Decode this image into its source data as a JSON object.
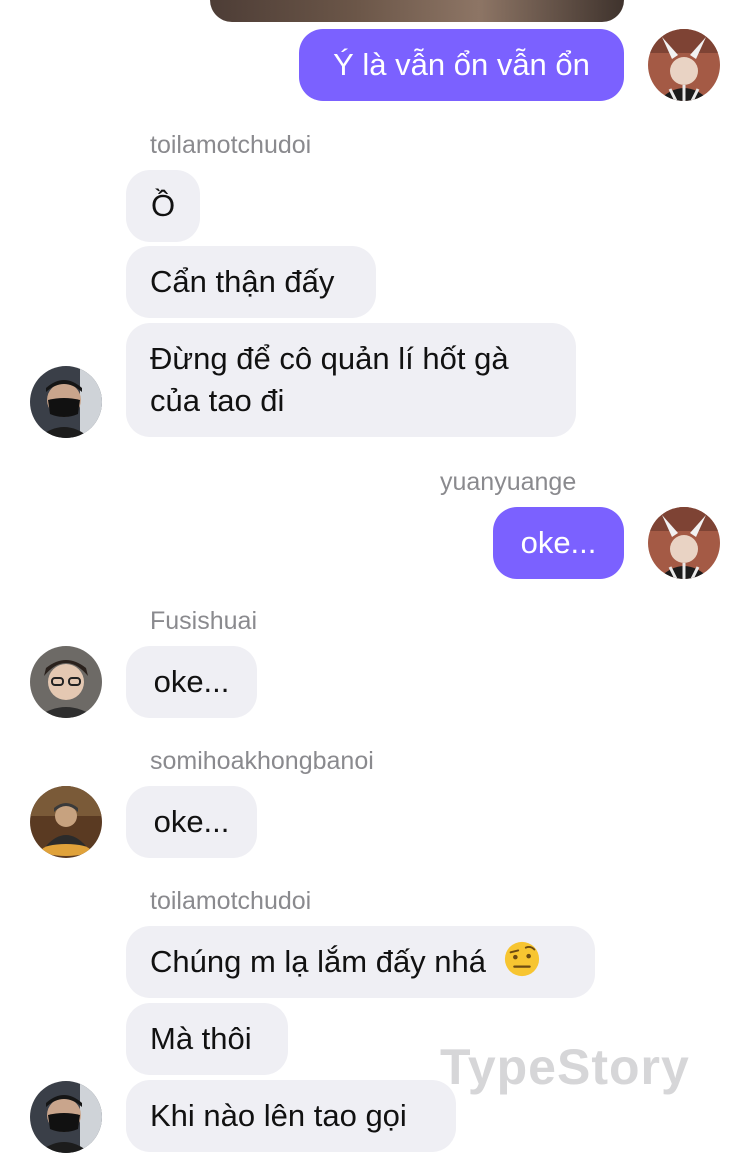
{
  "messages": [
    {
      "text": "Ý là vẫn ổn vẫn ổn"
    },
    {
      "sender": "toilamotchudoi"
    },
    {
      "text": "Ồ"
    },
    {
      "text": "Cẩn thận đấy"
    },
    {
      "line1": "Đừng để cô quản lí hốt gà",
      "line2": "của tao đi"
    },
    {
      "sender": "yuanyuange",
      "text": "oke..."
    },
    {
      "sender": "Fusishuai",
      "text": "oke..."
    },
    {
      "sender": "somihoakhongbanoi",
      "text": "oke..."
    },
    {
      "sender": "toilamotchudoi",
      "text": "Chúng m lạ lắm đấy nhá"
    },
    {
      "text": "Mà thôi"
    },
    {
      "text": "Khi nào lên tao gọi"
    }
  ],
  "emoji": "face-with-raised-eyebrow",
  "watermark": "TypeStory",
  "colors": {
    "outgoing_bubble": "#7b61ff",
    "incoming_bubble": "#efeff4",
    "sender_name": "#8a8a8e"
  }
}
